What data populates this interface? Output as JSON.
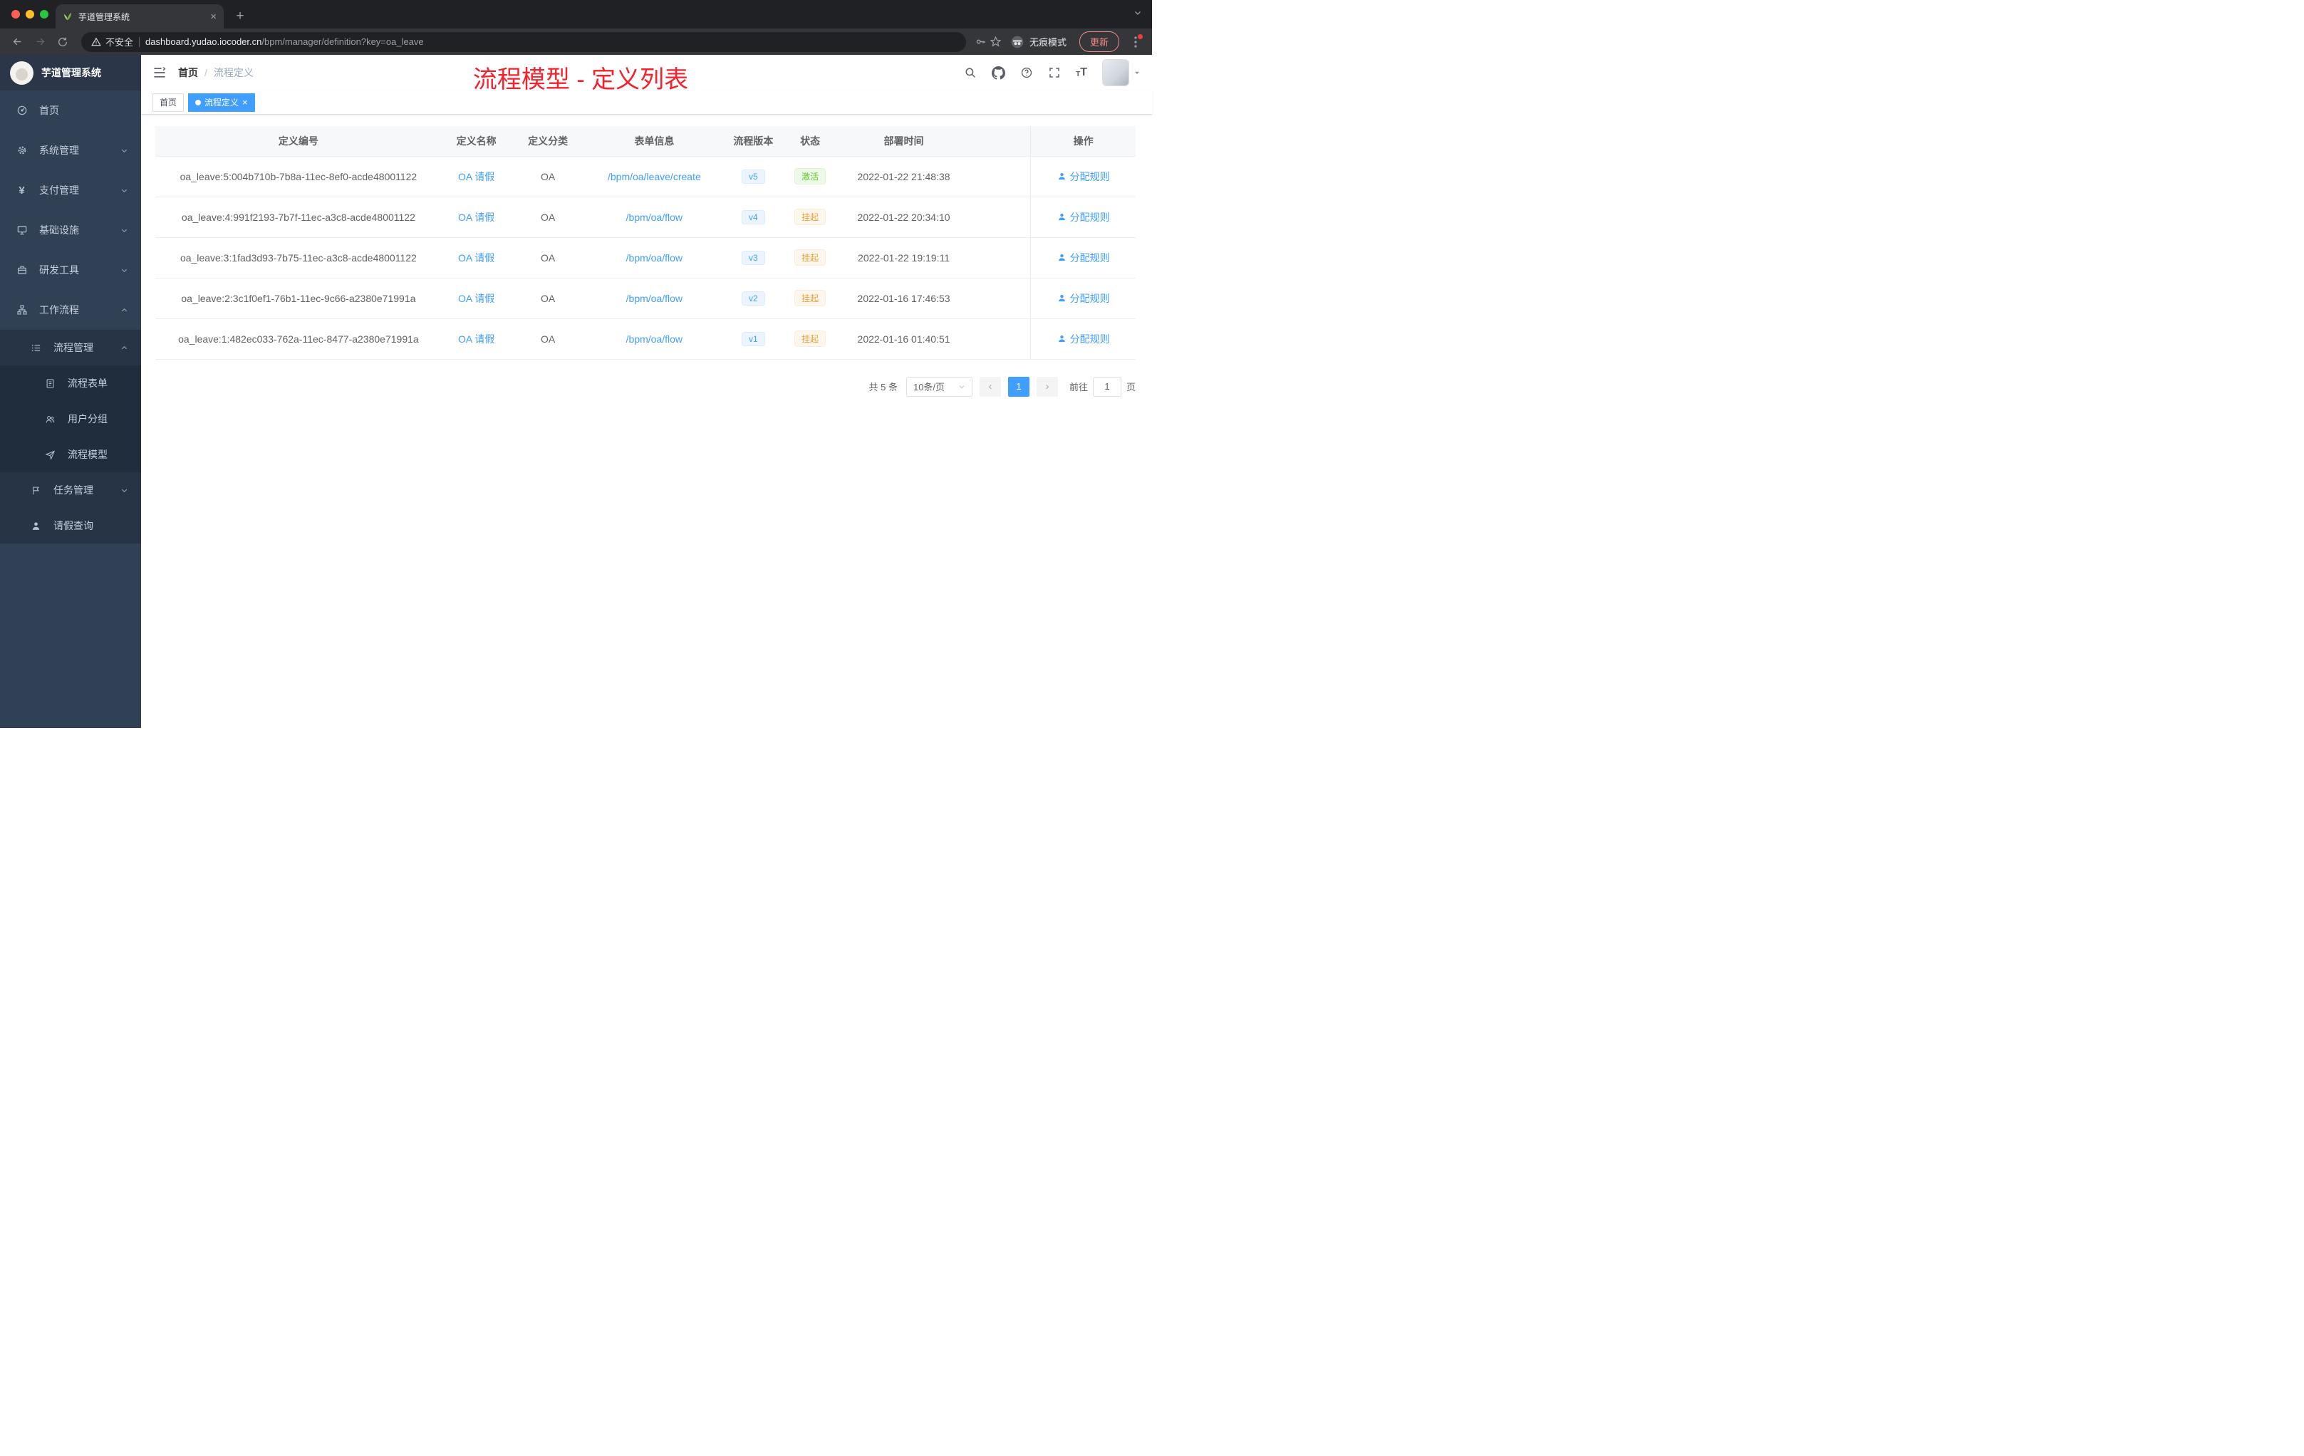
{
  "browser": {
    "tab_title": "芋道管理系统",
    "security_label": "不安全",
    "url_host": "dashboard.yudao.iocoder.cn",
    "url_path": "/bpm/manager/definition?key=oa_leave",
    "incognito_label": "无痕模式",
    "update_label": "更新"
  },
  "sidebar": {
    "title": "芋道管理系统",
    "items": [
      {
        "label": "首页"
      },
      {
        "label": "系统管理"
      },
      {
        "label": "支付管理"
      },
      {
        "label": "基础设施"
      },
      {
        "label": "研发工具"
      },
      {
        "label": "工作流程"
      }
    ],
    "submenu": {
      "process_management": "流程管理",
      "children": [
        {
          "label": "流程表单"
        },
        {
          "label": "用户分组"
        },
        {
          "label": "流程模型"
        }
      ],
      "task_management": "任务管理",
      "leave_query": "请假查询"
    }
  },
  "navbar": {
    "breadcrumb_home": "首页",
    "breadcrumb_sep": "/",
    "breadcrumb_current": "流程定义",
    "annotation": "流程模型 - 定义列表"
  },
  "tags": {
    "home": "首页",
    "current": "流程定义",
    "close": "×"
  },
  "table": {
    "headers": {
      "id": "定义编号",
      "name": "定义名称",
      "category": "定义分类",
      "form": "表单信息",
      "version": "流程版本",
      "status": "状态",
      "deploy_time": "部署时间",
      "actions": "操作"
    },
    "rows": [
      {
        "id": "oa_leave:5:004b710b-7b8a-11ec-8ef0-acde48001122",
        "name": "OA 请假",
        "category": "OA",
        "form": "/bpm/oa/leave/create",
        "version": "v5",
        "status": "激活",
        "deploy_time": "2022-01-22 21:48:38",
        "action": "分配规则"
      },
      {
        "id": "oa_leave:4:991f2193-7b7f-11ec-a3c8-acde48001122",
        "name": "OA 请假",
        "category": "OA",
        "form": "/bpm/oa/flow",
        "version": "v4",
        "status": "挂起",
        "deploy_time": "2022-01-22 20:34:10",
        "action": "分配规则"
      },
      {
        "id": "oa_leave:3:1fad3d93-7b75-11ec-a3c8-acde48001122",
        "name": "OA 请假",
        "category": "OA",
        "form": "/bpm/oa/flow",
        "version": "v3",
        "status": "挂起",
        "deploy_time": "2022-01-22 19:19:11",
        "action": "分配规则"
      },
      {
        "id": "oa_leave:2:3c1f0ef1-76b1-11ec-9c66-a2380e71991a",
        "name": "OA 请假",
        "category": "OA",
        "form": "/bpm/oa/flow",
        "version": "v2",
        "status": "挂起",
        "deploy_time": "2022-01-16 17:46:53",
        "action": "分配规则"
      },
      {
        "id": "oa_leave:1:482ec033-762a-11ec-8477-a2380e71991a",
        "name": "OA 请假",
        "category": "OA",
        "form": "/bpm/oa/flow",
        "version": "v1",
        "status": "挂起",
        "deploy_time": "2022-01-16 01:40:51",
        "action": "分配规则"
      }
    ]
  },
  "pagination": {
    "total": "共 5 条",
    "page_size": "10条/页",
    "current_page": "1",
    "goto_label": "前往",
    "goto_value": "1",
    "page_label": "页"
  },
  "colors": {
    "accent_blue": "#409eff",
    "success_green": "#5ec829",
    "warning_orange": "#e6a23c",
    "annotation_red": "#f5222d",
    "sidebar_bg": "#304156",
    "submenu_bg": "#1f2d3d"
  }
}
